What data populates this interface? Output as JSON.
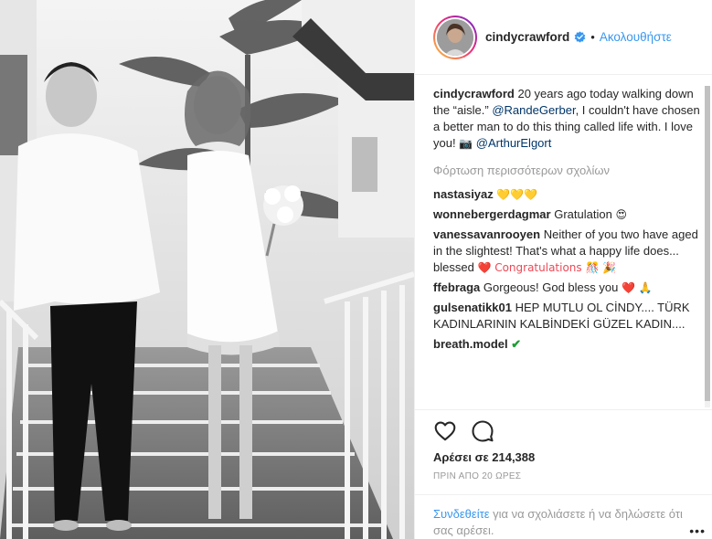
{
  "post": {
    "photo_label": "wedding-photo",
    "header": {
      "username": "cindycrawford",
      "separator": "•",
      "follow_label": "Ακολουθήστε"
    },
    "caption": {
      "username": "cindycrawford",
      "text_1": "20 years ago today walking down the “aisle.”",
      "mention_1": "@RandeGerber",
      "text_2": ", I couldn't have chosen a better man to do this thing called life with. I love you!",
      "camera": "📷",
      "mention_2": "@ArthurElgort"
    },
    "load_more_label": "Φόρτωση περισσότερων σχολίων",
    "comments": [
      {
        "username": "nastasiyaz",
        "text": "",
        "emoji": "💛💛💛"
      },
      {
        "username": "wonnebergerdagmar",
        "text": "Gratulation",
        "emoji": "😍"
      },
      {
        "username": "vanessavanrooyen",
        "text": "Neither of you two have aged in the slightest! That's what a happy life does... blessed",
        "emoji": "❤️ Congratulations 🎊 🎉"
      },
      {
        "username": "ffebraga",
        "text": "Gorgeous! God bless you",
        "emoji": "❤️ 🙏"
      },
      {
        "username": "gulsenatikk01",
        "text": "HEP MUTLU OL CİNDY.... TÜRK KADINLARININ KALBİNDEKİ GÜZEL KADIN....",
        "emoji": ""
      },
      {
        "username": "breath.model",
        "text": "",
        "emoji": "✔"
      }
    ],
    "likes_text": "Αρέσει σε 214,388",
    "time_text": "ΠΡΙΝ ΑΠΟ 20 ΩΡΕΣ",
    "login_prompt": {
      "link": "Συνδεθείτε",
      "text": " για να σχολιάσετε ή να δηλώσετε ότι σας αρέσει."
    },
    "more_label": "•••",
    "icons": {
      "like": "heart-icon",
      "comment": "comment-icon",
      "verified": "verified-badge-icon"
    },
    "colors": {
      "accent": "#3897f0",
      "text": "#262626",
      "muted": "#999999",
      "mention": "#003569",
      "heart": "#ed4956"
    }
  }
}
